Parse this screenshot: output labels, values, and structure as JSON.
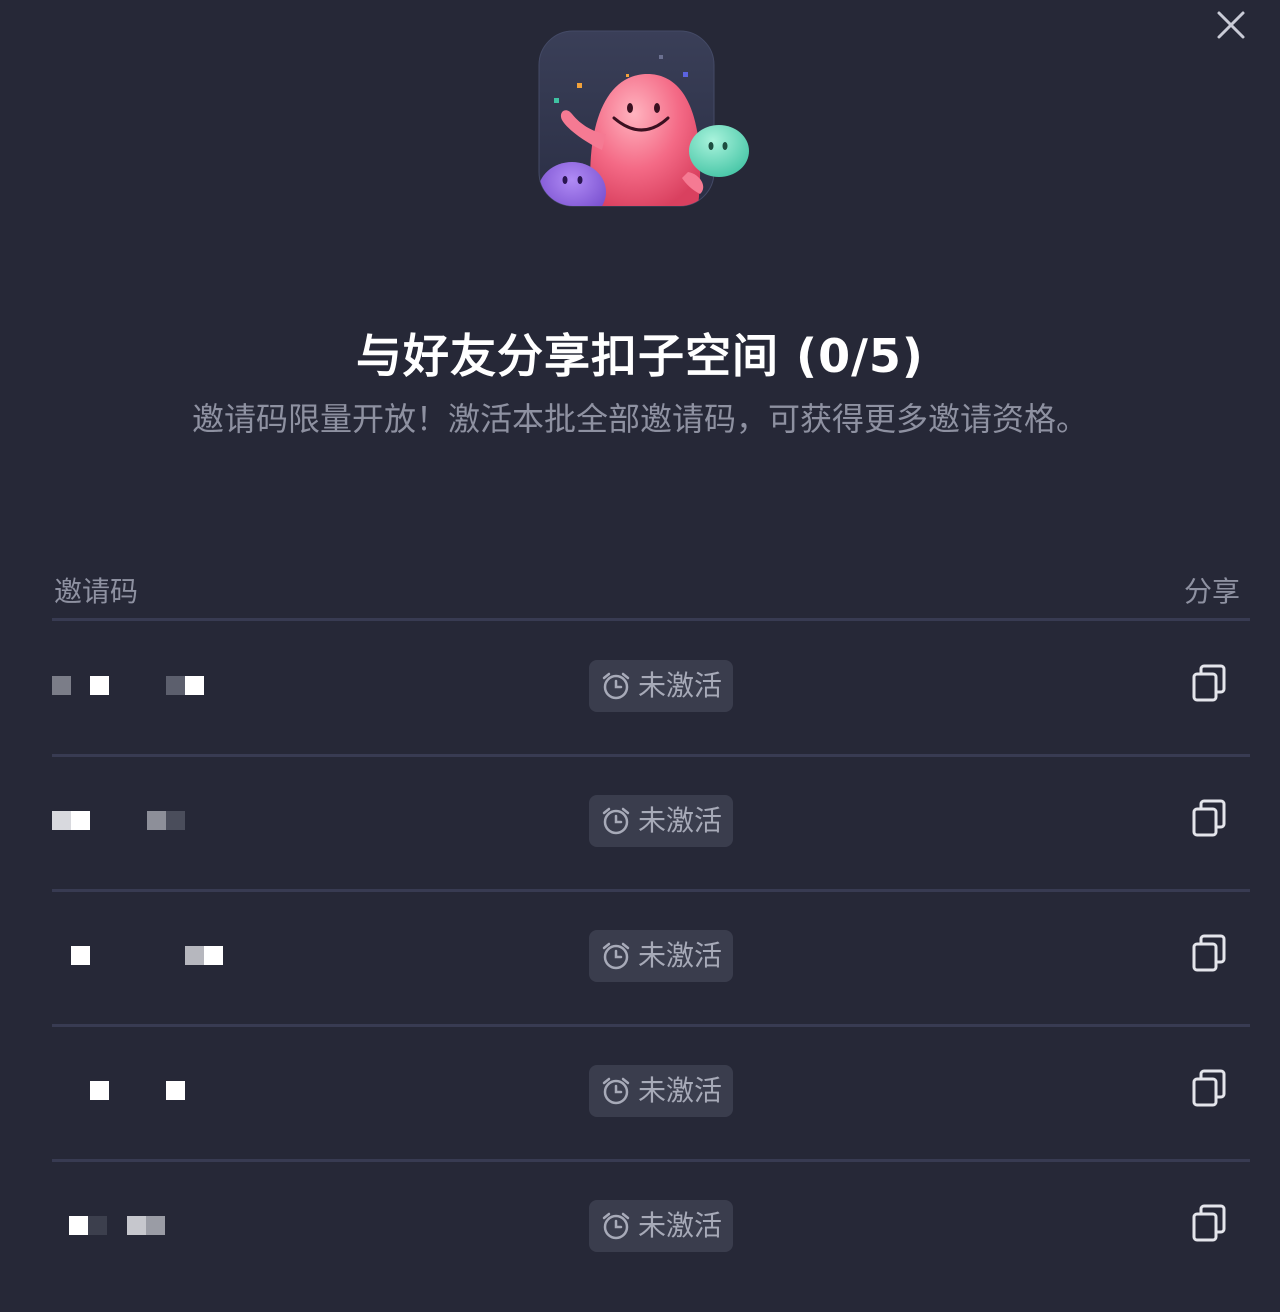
{
  "dialog": {
    "title": "与好友分享扣子空间 (0/5)",
    "subtitle": "邀请码限量开放！激活本批全部邀请码，可获得更多邀请资格。"
  },
  "table": {
    "col_code": "邀请码",
    "col_share": "分享",
    "rows": [
      {
        "status": "未激活"
      },
      {
        "status": "未激活"
      },
      {
        "status": "未激活"
      },
      {
        "status": "未激活"
      },
      {
        "status": "未激活"
      }
    ]
  },
  "icons": {
    "close": "close-icon",
    "status": "alarm-clock-icon",
    "copy": "copy-icon"
  },
  "colors": {
    "background": "#262837",
    "divider": "#383b52",
    "badge_bg": "#3a3d4d",
    "muted_text": "#8e91a1"
  }
}
